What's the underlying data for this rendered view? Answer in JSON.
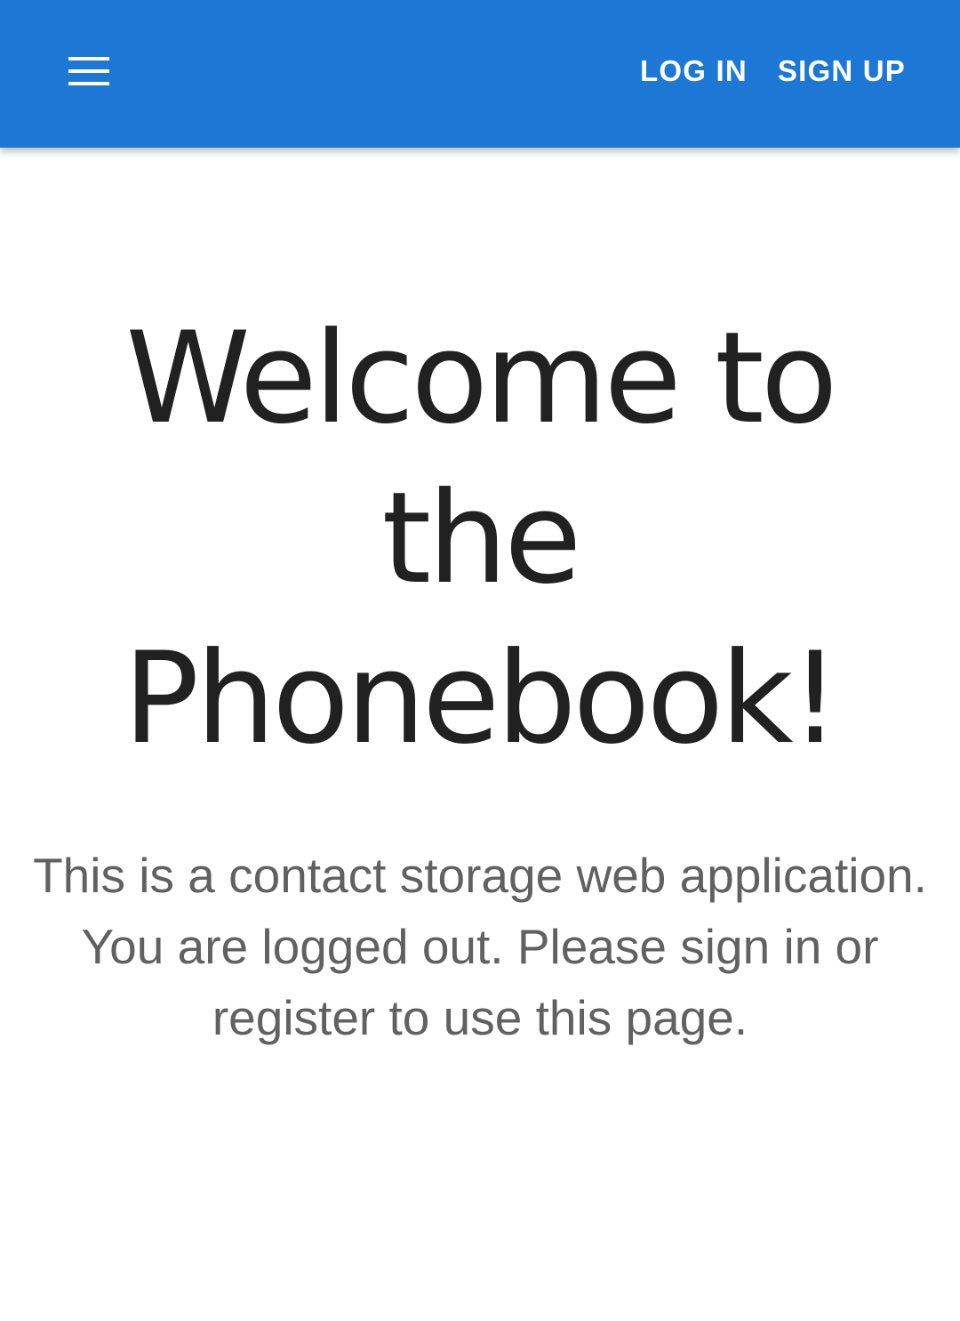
{
  "header": {
    "menu_icon": "hamburger-menu-icon",
    "actions": [
      {
        "label": "LOG IN"
      },
      {
        "label": "SIGN UP"
      }
    ]
  },
  "main": {
    "title": "Welcome to the Phonebook!",
    "description": "This is a contact storage web application. You are logged out. Please sign in or register to use this page."
  },
  "colors": {
    "app_bar": "#1c78d4",
    "app_bar_text": "#ffffff",
    "title_text": "#212121",
    "body_text": "#616161",
    "background": "#ffffff"
  }
}
